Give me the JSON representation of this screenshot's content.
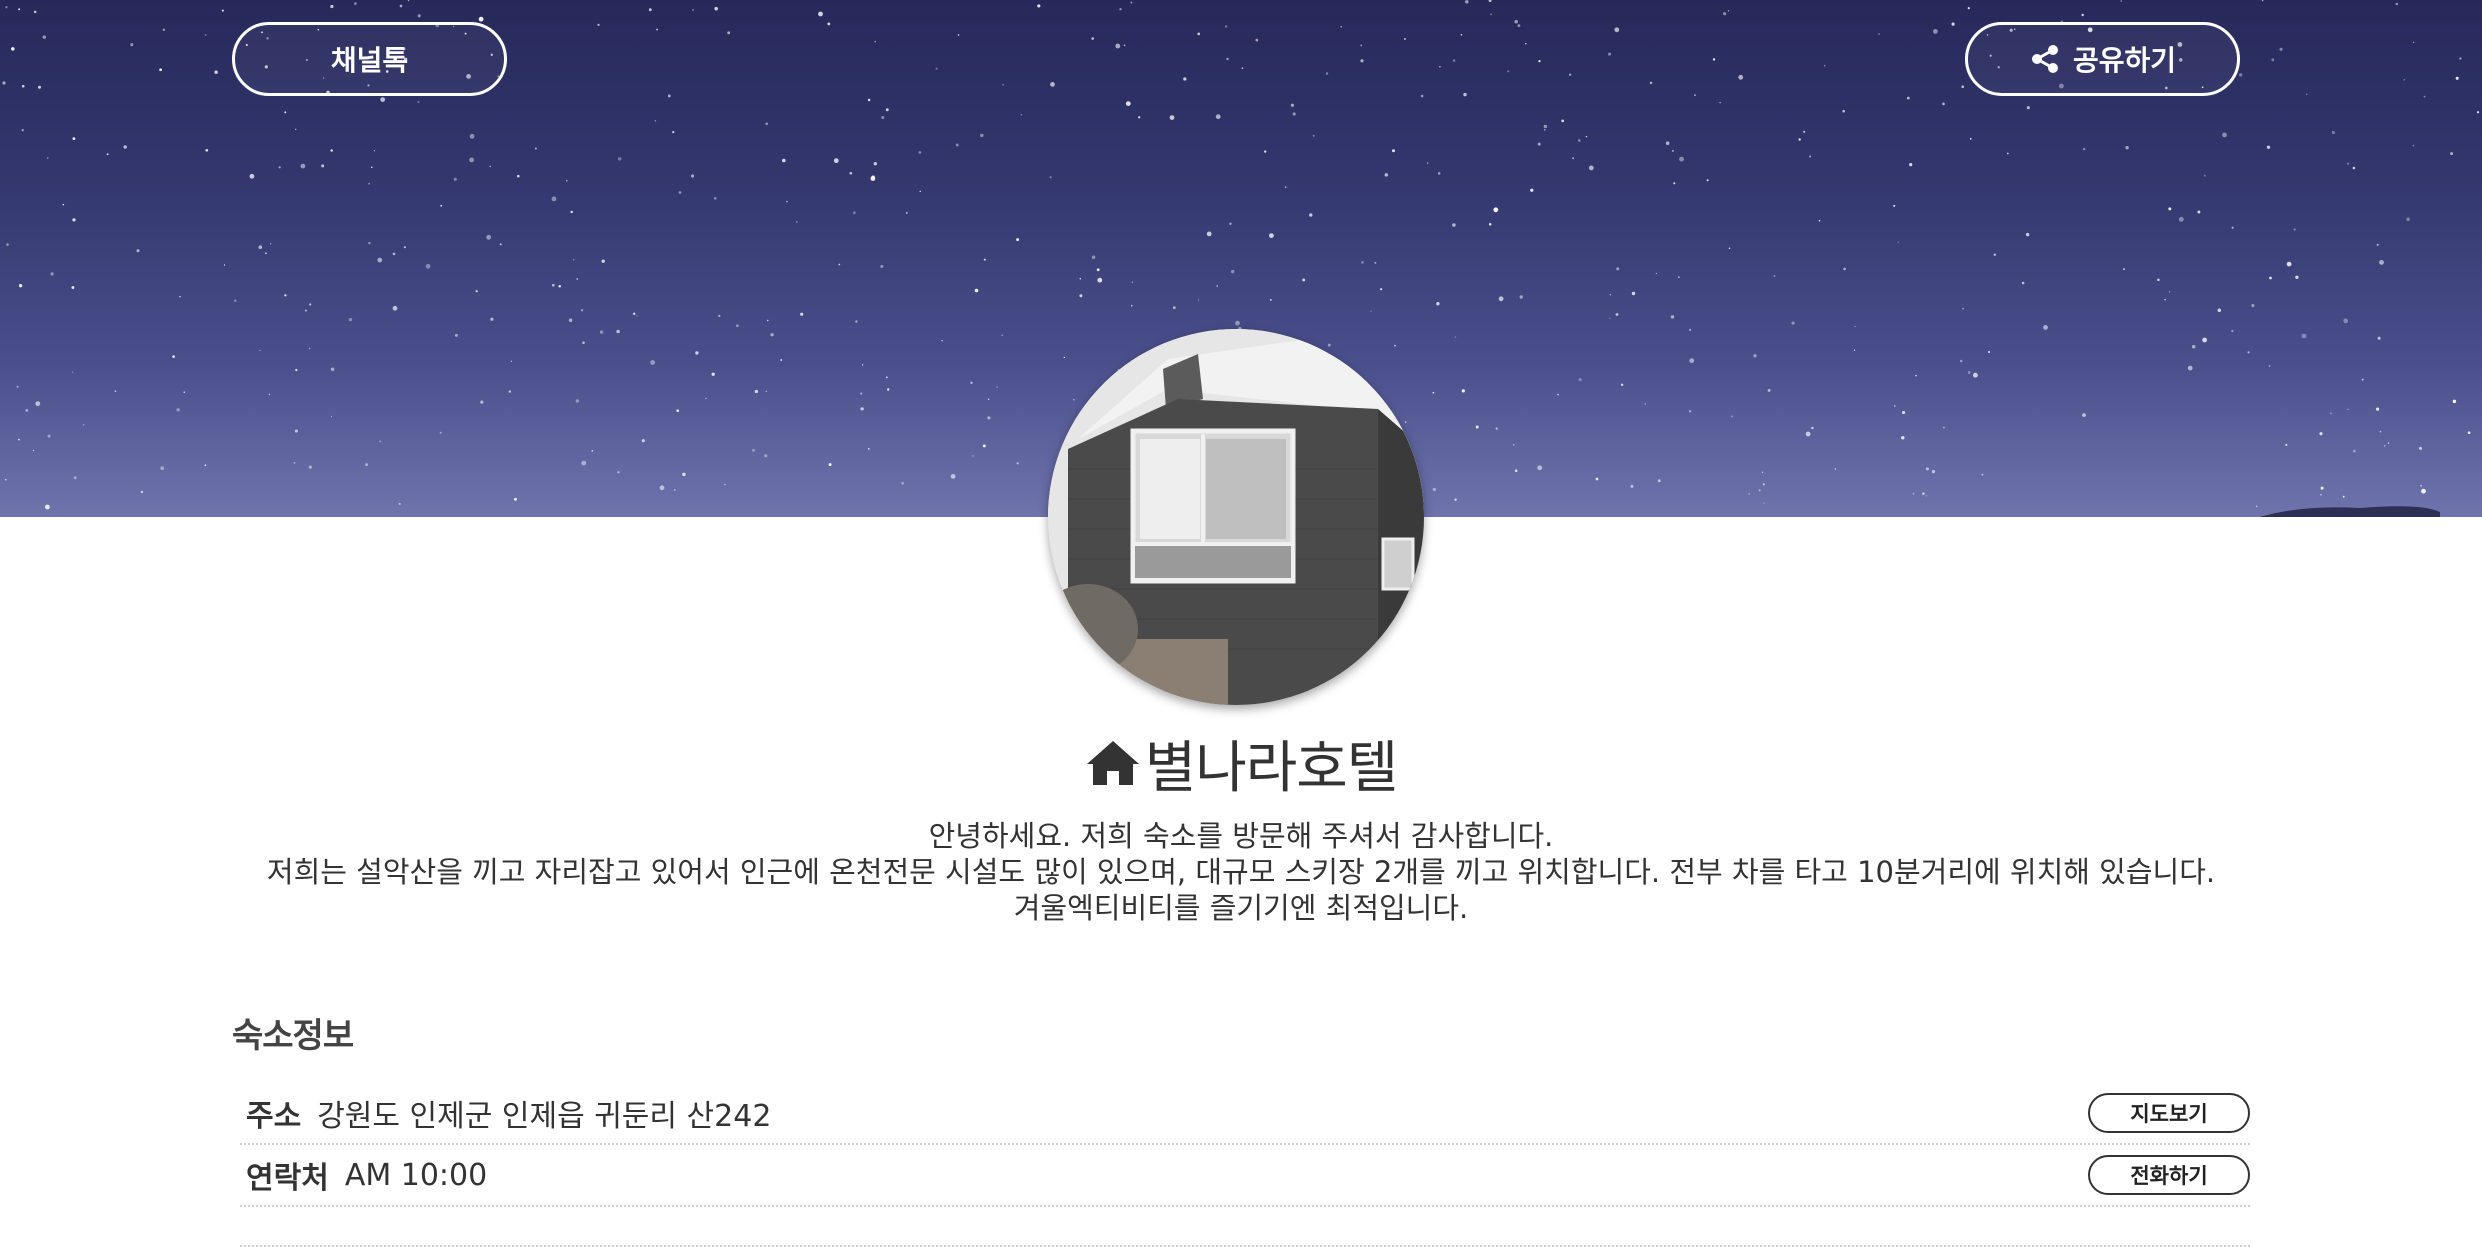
{
  "header": {
    "channel_label": "채널톡",
    "share_label": "공유하기"
  },
  "icons": {
    "share": "share-icon",
    "home": "home-icon"
  },
  "hotel": {
    "name": "별나라호텔",
    "description_lines": [
      "안녕하세요. 저희 숙소를 방문해 주셔서 감사합니다.",
      "저희는 설악산을 끼고 자리잡고 있어서 인근에 온천전문 시설도 많이 있으며, 대규모 스키장 2개를 끼고 위치합니다. 전부 차를 타고 10분거리에 위치해 있습니다.",
      "겨울엑티비티를 즐기기엔 최적입니다."
    ]
  },
  "info": {
    "section_title": "숙소정보",
    "address_label": "주소",
    "address_value": "강원도 인제군 인제읍 귀둔리 산242",
    "map_button": "지도보기",
    "contact_label": "연락처",
    "contact_value": "AM 10:00",
    "call_button": "전화하기"
  },
  "colors": {
    "sky_top": "#27295a",
    "sky_bottom": "#6f74ad",
    "text": "#333333"
  }
}
